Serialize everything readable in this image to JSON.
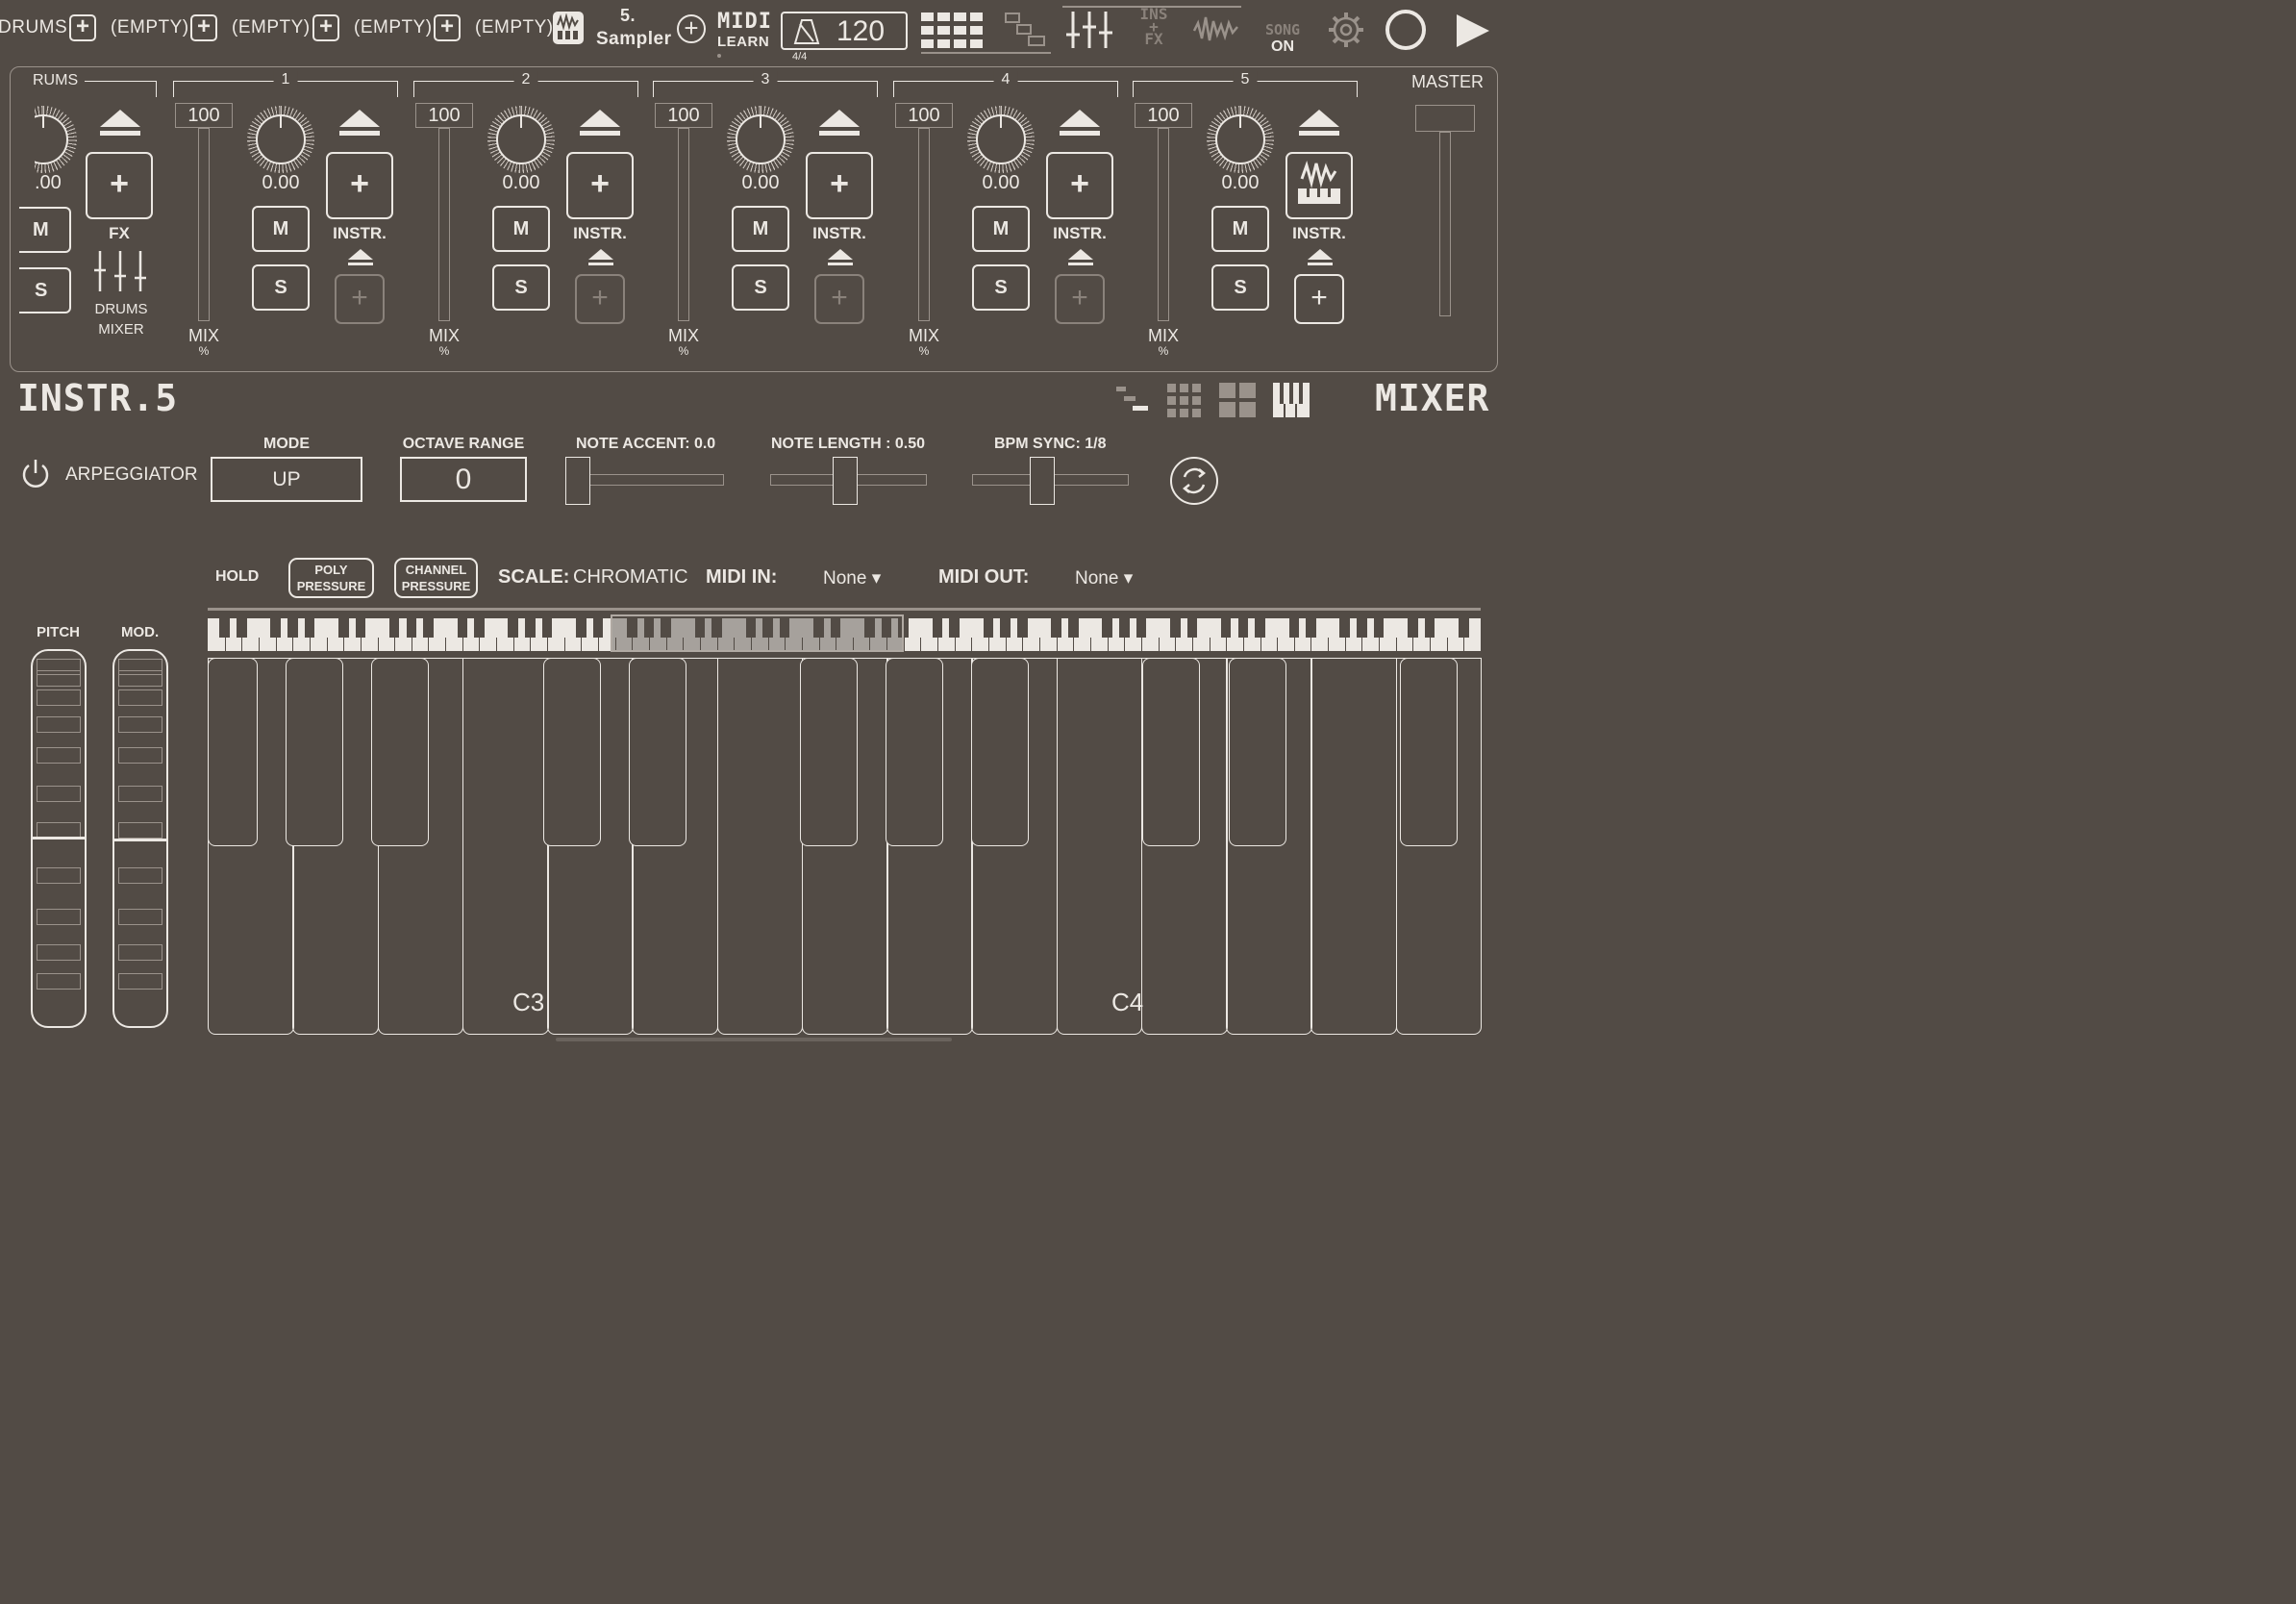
{
  "top_bar": {
    "drums_label": "DRUMS",
    "empty_slots": [
      "(EMPTY)",
      "(EMPTY)",
      "(EMPTY)",
      "(EMPTY)"
    ],
    "current_track_number": "5.",
    "current_track_name": "Sampler",
    "midi_learn": {
      "top": "MIDI",
      "bottom": "LEARN"
    },
    "bpm": "120",
    "time_signature": "4/4",
    "ins_fx": {
      "top": "INS",
      "mid": "+",
      "bottom": "FX"
    },
    "song": {
      "top": "SONG",
      "bottom": "ON"
    }
  },
  "mixer": {
    "drums_header": "RUMS",
    "drums_value": ".00",
    "drums_mute": "M",
    "drums_solo": "S",
    "fx_label": "FX",
    "drums_mixer_label": [
      "DRUMS",
      "MIXER"
    ],
    "master_label": "MASTER",
    "channels": [
      {
        "number": "1",
        "volume": "100",
        "pan": "0.00",
        "mute": "M",
        "solo": "S",
        "instr_label": "INSTR.",
        "mix": "MIX",
        "mix_unit": "%"
      },
      {
        "number": "2",
        "volume": "100",
        "pan": "0.00",
        "mute": "M",
        "solo": "S",
        "instr_label": "INSTR.",
        "mix": "MIX",
        "mix_unit": "%"
      },
      {
        "number": "3",
        "volume": "100",
        "pan": "0.00",
        "mute": "M",
        "solo": "S",
        "instr_label": "INSTR.",
        "mix": "MIX",
        "mix_unit": "%"
      },
      {
        "number": "4",
        "volume": "100",
        "pan": "0.00",
        "mute": "M",
        "solo": "S",
        "instr_label": "INSTR.",
        "mix": "MIX",
        "mix_unit": "%"
      },
      {
        "number": "5",
        "volume": "100",
        "pan": "0.00",
        "mute": "M",
        "solo": "S",
        "instr_label": "INSTR.",
        "mix": "MIX",
        "mix_unit": "%"
      }
    ]
  },
  "instrument_title": "INSTR.5",
  "mixer_title": "MIXER",
  "arpeggiator": {
    "label": "ARPEGGIATOR",
    "mode_label": "MODE",
    "mode_value": "UP",
    "octave_label": "OCTAVE RANGE",
    "octave_value": "0",
    "note_accent_label": "NOTE ACCENT: 0.0",
    "note_accent_value": 0.0,
    "note_length_label": "NOTE LENGTH : 0.50",
    "note_length_value": 0.5,
    "bpm_sync_label": "BPM SYNC: 1/8"
  },
  "keyboard_bar": {
    "hold": "HOLD",
    "poly_pressure": [
      "POLY",
      "PRESSURE"
    ],
    "channel_pressure": [
      "CHANNEL",
      "PRESSURE"
    ],
    "scale_label": "SCALE:",
    "scale_value": "CHROMATIC",
    "midi_in_label": "MIDI IN:",
    "midi_in_value": "None ▾",
    "midi_out_label": "MIDI OUT:",
    "midi_out_value": "None ▾"
  },
  "wheels": {
    "pitch": "PITCH",
    "mod": "MOD."
  },
  "key_labels": {
    "c3": "C3",
    "c4": "C4"
  }
}
